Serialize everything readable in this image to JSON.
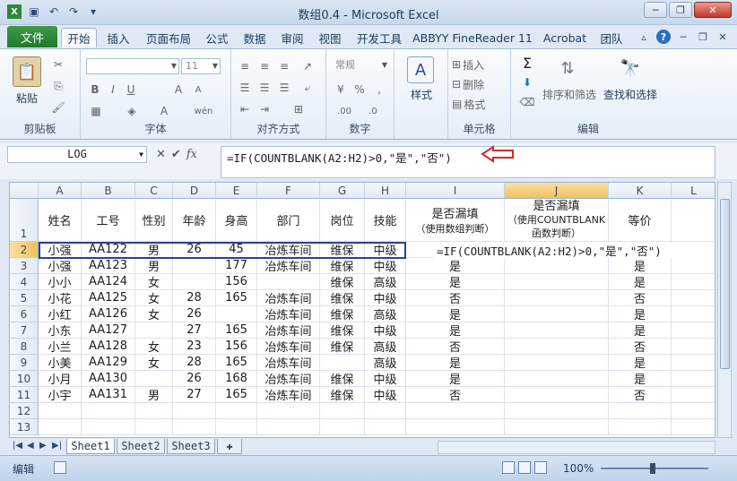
{
  "window": {
    "title": "数组0.4 - Microsoft Excel"
  },
  "tabs": {
    "file": "文件",
    "items": [
      "开始",
      "插入",
      "页面布局",
      "公式",
      "数据",
      "审阅",
      "视图",
      "开发工具",
      "ABBYY FineReader 11",
      "Acrobat",
      "团队"
    ],
    "active": "开始"
  },
  "ribbon": {
    "clipboard": {
      "label": "剪贴板",
      "paste": "粘贴"
    },
    "font": {
      "label": "字体",
      "size": "11"
    },
    "alignment": {
      "label": "对齐方式"
    },
    "number": {
      "label": "数字",
      "format": "常规"
    },
    "styles": {
      "label": "样式"
    },
    "cells": {
      "label": "单元格",
      "insert": "插入",
      "delete": "删除",
      "format": "格式"
    },
    "editing": {
      "label": "编辑",
      "sort": "排序和筛选",
      "find": "查找和选择"
    }
  },
  "formula_bar": {
    "name_box": "LOG",
    "formula": "=IF(COUNTBLANK(A2:H2)>0,\"是\",\"否\")"
  },
  "grid": {
    "columns": [
      "A",
      "B",
      "C",
      "D",
      "E",
      "F",
      "G",
      "H",
      "I",
      "J",
      "K",
      "L"
    ],
    "rows": [
      "1",
      "2",
      "3",
      "4",
      "5",
      "6",
      "7",
      "8",
      "9",
      "10",
      "11",
      "12",
      "13"
    ],
    "headers": {
      "A": "姓名",
      "B": "工号",
      "C": "性别",
      "D": "年龄",
      "E": "身高",
      "F": "部门",
      "G": "岗位",
      "H": "技能",
      "I_main": "是否漏填",
      "I_sub": "（使用数组判断）",
      "J_main": "是否漏填",
      "J_sub1": "（使用COUNTBLANK",
      "J_sub2": "函数判断）",
      "K": "等价"
    },
    "data": [
      [
        "小强",
        "AA122",
        "男",
        "26",
        "45",
        "冶炼车间",
        "维保",
        "中级",
        "",
        "",
        ""
      ],
      [
        "小强",
        "AA123",
        "男",
        "",
        "177",
        "冶炼车间",
        "维保",
        "中级",
        "是",
        "",
        "是"
      ],
      [
        "小小",
        "AA124",
        "女",
        "",
        "156",
        "",
        "维保",
        "高级",
        "是",
        "",
        "是"
      ],
      [
        "小花",
        "AA125",
        "女",
        "28",
        "165",
        "冶炼车间",
        "维保",
        "中级",
        "否",
        "",
        "否"
      ],
      [
        "小红",
        "AA126",
        "女",
        "26",
        "",
        "冶炼车间",
        "维保",
        "高级",
        "是",
        "",
        "是"
      ],
      [
        "小东",
        "AA127",
        "",
        "27",
        "165",
        "冶炼车间",
        "维保",
        "中级",
        "是",
        "",
        "是"
      ],
      [
        "小兰",
        "AA128",
        "女",
        "23",
        "156",
        "冶炼车间",
        "维保",
        "高级",
        "否",
        "",
        "否"
      ],
      [
        "小美",
        "AA129",
        "女",
        "28",
        "165",
        "冶炼车间",
        "",
        "高级",
        "是",
        "",
        "是"
      ],
      [
        "小月",
        "AA130",
        "",
        "26",
        "168",
        "冶炼车间",
        "维保",
        "中级",
        "是",
        "",
        "是"
      ],
      [
        "小宇",
        "AA131",
        "男",
        "27",
        "165",
        "冶炼车间",
        "维保",
        "中级",
        "否",
        "",
        "否"
      ]
    ],
    "editing_cell_text": "=IF(COUNTBLANK(A2:H2)>0,\"是\",\"否\")"
  },
  "sheets": [
    "Sheet1",
    "Sheet2",
    "Sheet3"
  ],
  "active_sheet": "Sheet1",
  "status": {
    "mode": "编辑",
    "zoom": "100%"
  },
  "colors": {
    "accent_red": "#d62a2a",
    "file_tab": "#2a8a35",
    "selection_border": "#2a3ea0"
  }
}
